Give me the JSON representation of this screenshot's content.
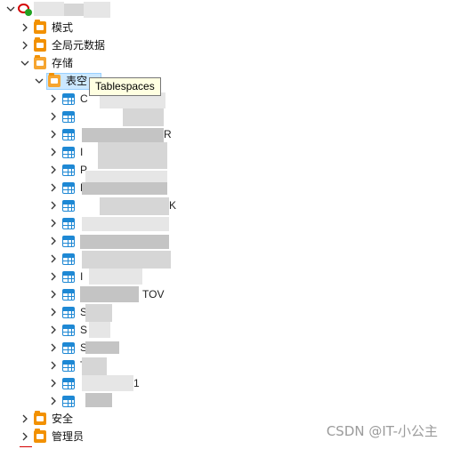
{
  "tree": {
    "root": {
      "label": ""
    },
    "items": [
      {
        "label": "模式"
      },
      {
        "label": "全局元数据"
      },
      {
        "label": "存储"
      }
    ],
    "storage_child": {
      "label": "表空"
    },
    "tablespaces": [
      {
        "visible_text": "C"
      },
      {
        "visible_text": ""
      },
      {
        "visible_text": "R"
      },
      {
        "visible_text": "I"
      },
      {
        "visible_text": "P"
      },
      {
        "visible_text": "P"
      },
      {
        "visible_text": "K"
      },
      {
        "visible_text": "i"
      },
      {
        "visible_text": ""
      },
      {
        "visible_text": ""
      },
      {
        "visible_text": "I"
      },
      {
        "visible_text": "TOV"
      },
      {
        "visible_text": "S"
      },
      {
        "visible_text": "S"
      },
      {
        "visible_text": "S"
      },
      {
        "visible_text": "T"
      },
      {
        "visible_text": "1"
      },
      {
        "visible_text": ""
      }
    ],
    "bottom_items": [
      {
        "label": "安全"
      },
      {
        "label": "管理员"
      }
    ]
  },
  "tooltip": {
    "text": "Tablespaces"
  },
  "watermark": {
    "text": "CSDN @IT-小公主"
  },
  "icons": {
    "root": "database-connected-icon",
    "folder": "folder-icon",
    "table": "tablespace-icon",
    "chevron": "chevron-icon"
  },
  "colors": {
    "accent": "#f29100",
    "table_blue": "#1e88d4",
    "connection_red": "#d40000",
    "status_green": "#21a121"
  }
}
